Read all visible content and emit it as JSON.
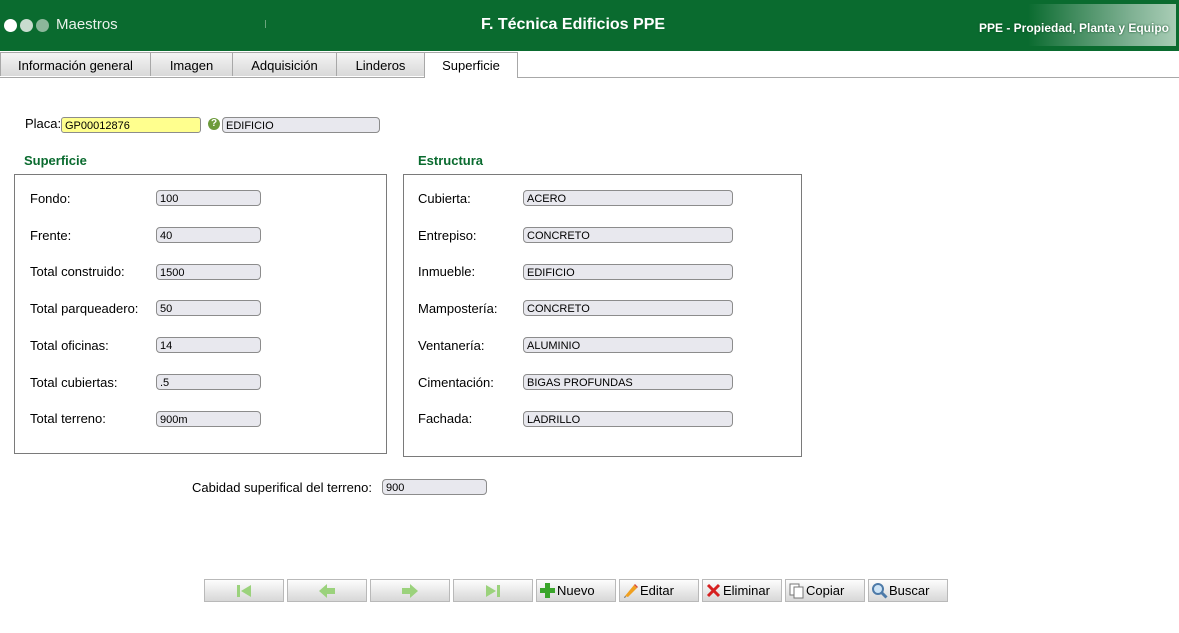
{
  "header": {
    "module_label": "Maestros",
    "title": "F. Técnica Edificios PPE",
    "brand_text": "PPE - Propiedad, Planta y Equipo"
  },
  "tabs": [
    {
      "label": "Información general",
      "active": false
    },
    {
      "label": "Imagen",
      "active": false
    },
    {
      "label": "Adquisición",
      "active": false
    },
    {
      "label": "Linderos",
      "active": false
    },
    {
      "label": "Superficie",
      "active": true
    }
  ],
  "placa": {
    "label": "Placa:",
    "value": "GP00012876",
    "description": "EDIFICIO"
  },
  "superficie": {
    "title": "Superficie",
    "fields": [
      {
        "label": "Fondo:",
        "value": "100"
      },
      {
        "label": "Frente:",
        "value": "40"
      },
      {
        "label": "Total construido:",
        "value": "1500"
      },
      {
        "label": "Total parqueadero:",
        "value": "50"
      },
      {
        "label": "Total oficinas:",
        "value": "14"
      },
      {
        "label": "Total cubiertas:",
        "value": ".5"
      },
      {
        "label": "Total terreno:",
        "value": "900m"
      }
    ]
  },
  "estructura": {
    "title": "Estructura",
    "fields": [
      {
        "label": "Cubierta:",
        "value": "ACERO"
      },
      {
        "label": "Entrepiso:",
        "value": "CONCRETO"
      },
      {
        "label": "Inmueble:",
        "value": "EDIFICIO"
      },
      {
        "label": "Mampostería:",
        "value": "CONCRETO"
      },
      {
        "label": "Ventanería:",
        "value": "ALUMINIO"
      },
      {
        "label": "Cimentación:",
        "value": "BIGAS PROFUNDAS"
      },
      {
        "label": "Fachada:",
        "value": "LADRILLO"
      }
    ]
  },
  "cabidad": {
    "label": "Cabidad superifical del terreno:",
    "value": "900"
  },
  "toolbar": {
    "nav": [
      {
        "name": "first-record-button",
        "icon": "first-icon"
      },
      {
        "name": "previous-record-button",
        "icon": "arrow-left-icon"
      },
      {
        "name": "next-record-button",
        "icon": "arrow-right-icon"
      },
      {
        "name": "last-record-button",
        "icon": "last-icon"
      }
    ],
    "actions": [
      {
        "name": "nuevo-button",
        "icon": "plus-icon",
        "label": "Nuevo"
      },
      {
        "name": "editar-button",
        "icon": "pencil-icon",
        "label": "Editar"
      },
      {
        "name": "eliminar-button",
        "icon": "x-icon",
        "label": "Eliminar"
      },
      {
        "name": "copiar-button",
        "icon": "copy-icon",
        "label": "Copiar"
      },
      {
        "name": "buscar-button",
        "icon": "magnifier-icon",
        "label": "Buscar"
      }
    ]
  },
  "colors": {
    "header_green": "#0a6b2f",
    "section_title": "#0a6b2f",
    "placa_highlight": "#ffff8e",
    "field_background": "#e8e8ee"
  }
}
